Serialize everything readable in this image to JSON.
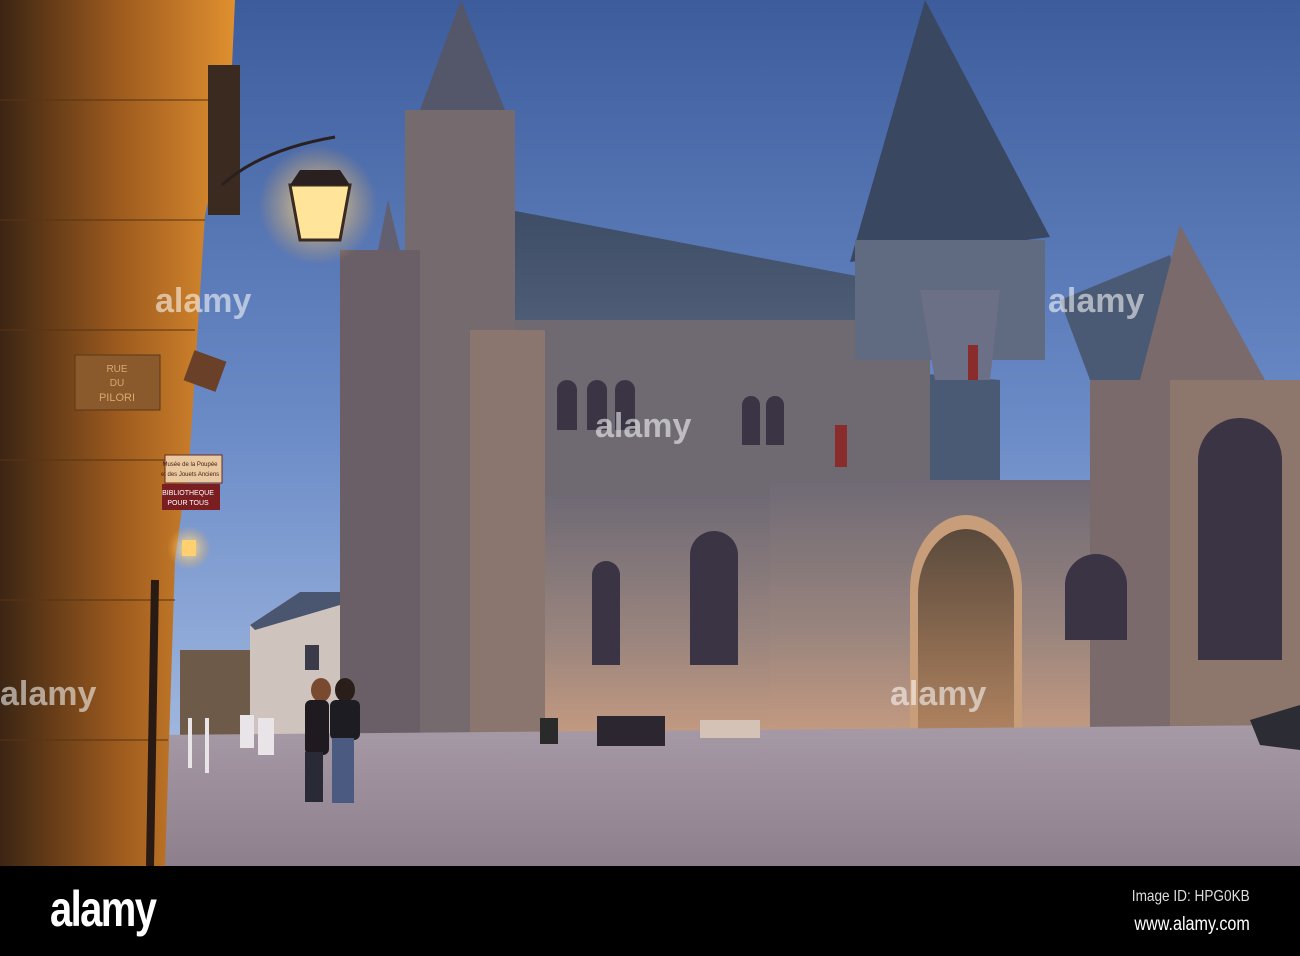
{
  "photo": {
    "street_sign": {
      "line1": "RUE",
      "line2": "DU",
      "line3": "PILORI"
    },
    "museum_sign": {
      "line1": "Musée de la Poupée",
      "line2": "et des Jouets Anciens"
    },
    "library_sign": {
      "line1": "BIBLIOTHEQUE",
      "line2": "POUR TOUS"
    },
    "watermark": "alamy"
  },
  "footer": {
    "logo": "alamy",
    "image_id": "Image ID: HPG0KB",
    "website": "www.alamy.com"
  },
  "colors": {
    "sky_top": "#3f5f9e",
    "sky_bottom": "#a9c2e6",
    "lamp": "#ffd27a",
    "footer": "#000000"
  }
}
